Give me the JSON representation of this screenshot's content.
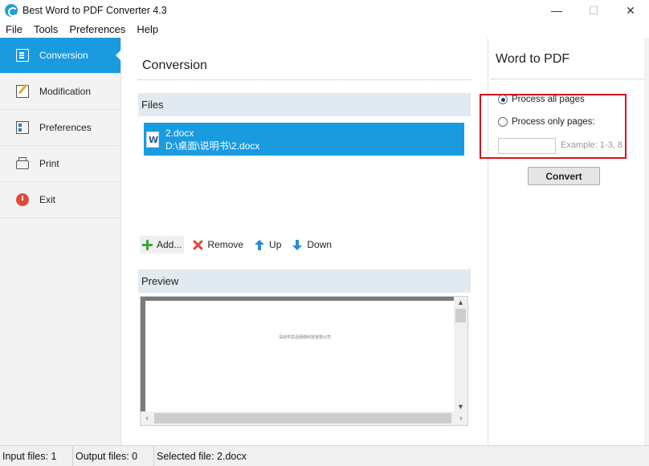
{
  "window": {
    "title": "Best Word to PDF Converter 4.3",
    "minimize": "—",
    "maximize": "☐",
    "close": "✕"
  },
  "menu": [
    "File",
    "Tools",
    "Preferences",
    "Help"
  ],
  "sidebar": {
    "items": [
      {
        "label": "Conversion",
        "icon": "document-icon",
        "active": true
      },
      {
        "label": "Modification",
        "icon": "edit-icon",
        "active": false
      },
      {
        "label": "Preferences",
        "icon": "checklist-icon",
        "active": false
      },
      {
        "label": "Print",
        "icon": "printer-icon",
        "active": false
      },
      {
        "label": "Exit",
        "icon": "power-icon",
        "active": false
      }
    ]
  },
  "main": {
    "title": "Conversion",
    "files_header": "Files",
    "files": [
      {
        "name": "2.docx",
        "path": "D:\\桌面\\说明书\\2.docx"
      }
    ],
    "toolbar": {
      "add": "Add...",
      "remove": "Remove",
      "up": "Up",
      "down": "Down"
    },
    "preview_header": "Preview",
    "preview_text": "深圳市思迅网络科技有限公司"
  },
  "right": {
    "title": "Word to PDF",
    "option_all": "Process all pages",
    "option_only": "Process only pages:",
    "range_value": "",
    "range_example": "Example: 1-3, 8",
    "convert": "Convert"
  },
  "status": {
    "input_files": "Input files: 1",
    "output_files": "Output files: 0",
    "selected_file": "Selected file: 2.docx"
  },
  "colors": {
    "accent": "#1a9be0",
    "section_header": "#e2eaf1",
    "highlight_border": "#d4141e"
  }
}
